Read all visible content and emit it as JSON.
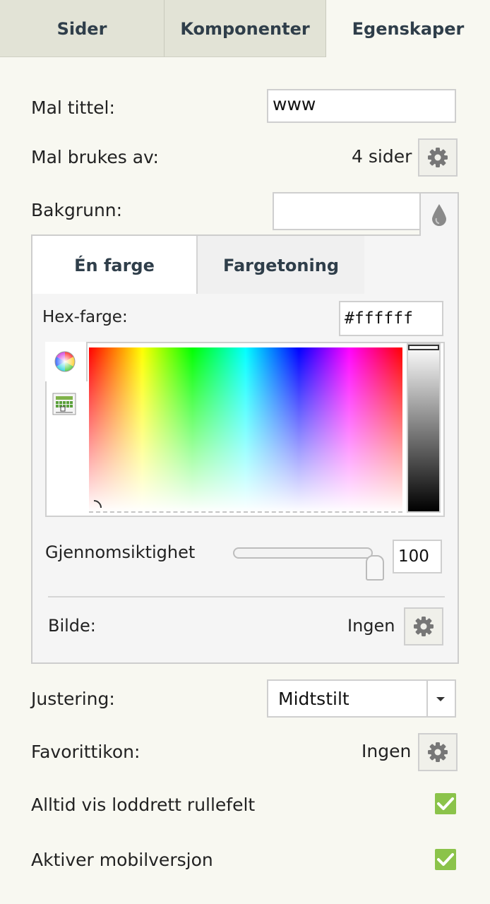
{
  "tabs": [
    {
      "label": "Sider",
      "active": false
    },
    {
      "label": "Komponenter",
      "active": false
    },
    {
      "label": "Egenskaper",
      "active": true
    }
  ],
  "template_title": {
    "label": "Mal tittel:",
    "value": "www"
  },
  "used_by": {
    "label": "Mal brukes av:",
    "value": "4 sider"
  },
  "background": {
    "label": "Bakgrunn:",
    "value": "",
    "panel": {
      "tabs": [
        {
          "label": "Én farge",
          "active": true
        },
        {
          "label": "Fargetoning",
          "active": false
        }
      ],
      "hex_label": "Hex-farge:",
      "hex_value": "#ffffff",
      "opacity_label": "Gjennomsiktighet",
      "opacity_value": "100",
      "image_label": "Bilde:",
      "image_value": "Ingen"
    }
  },
  "alignment": {
    "label": "Justering:",
    "value": "Midtstilt"
  },
  "favicon": {
    "label": "Favorittikon:",
    "value": "Ingen"
  },
  "always_scrollbar": {
    "label": "Alltid vis loddrett rullefelt",
    "checked": true
  },
  "mobile_version": {
    "label": "Aktiver mobilversjon",
    "checked": true
  },
  "colors": {
    "checkbox": "#8bc34a",
    "tab_inactive": "#e2e3d6",
    "background": "#f8f8f1"
  }
}
